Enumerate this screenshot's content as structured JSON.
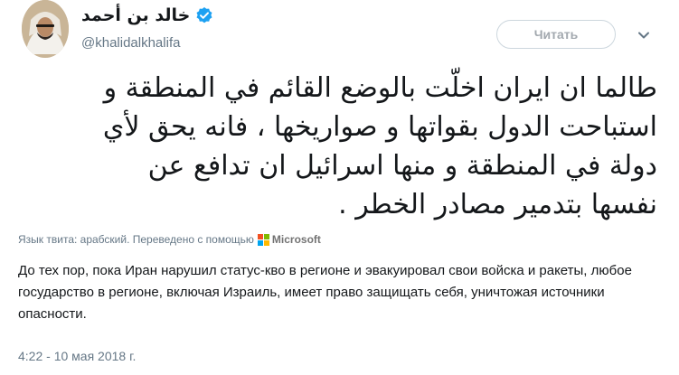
{
  "header": {
    "display_name": "خالد بن أحمد",
    "handle": "@khalidalkhalifa",
    "verified_icon": "verified-badge-icon",
    "follow_label": "Читать",
    "caret_icon": "chevron-down-icon"
  },
  "tweet": {
    "text": "طالما ان ايران اخلّت بالوضع القائم في المنطقة و\nاستباحت الدول بقواتها و صواريخها ، فانه يحق لأي\nدولة في المنطقة و منها اسرائيل ان تدافع عن\nنفسها بتدمير مصادر الخطر .",
    "translation_note": "Язык твита: арабский. Переведено с помощью",
    "translator_name": "Microsoft",
    "translation": "До тех пор, пока Иран нарушил статус-кво в регионе и эвакуировал свои войска и ракеты, любое государство в регионе, включая Израиль, имеет право защищать себя, уничтожая источники опасности.",
    "timestamp": "4:22 - 10 мая 2018 г."
  },
  "colors": {
    "verified_blue": "#1da1f2",
    "ms_red": "#f25022",
    "ms_green": "#7fba00",
    "ms_blue": "#00a4ef",
    "ms_yellow": "#ffb900",
    "secondary_text": "#657786"
  }
}
